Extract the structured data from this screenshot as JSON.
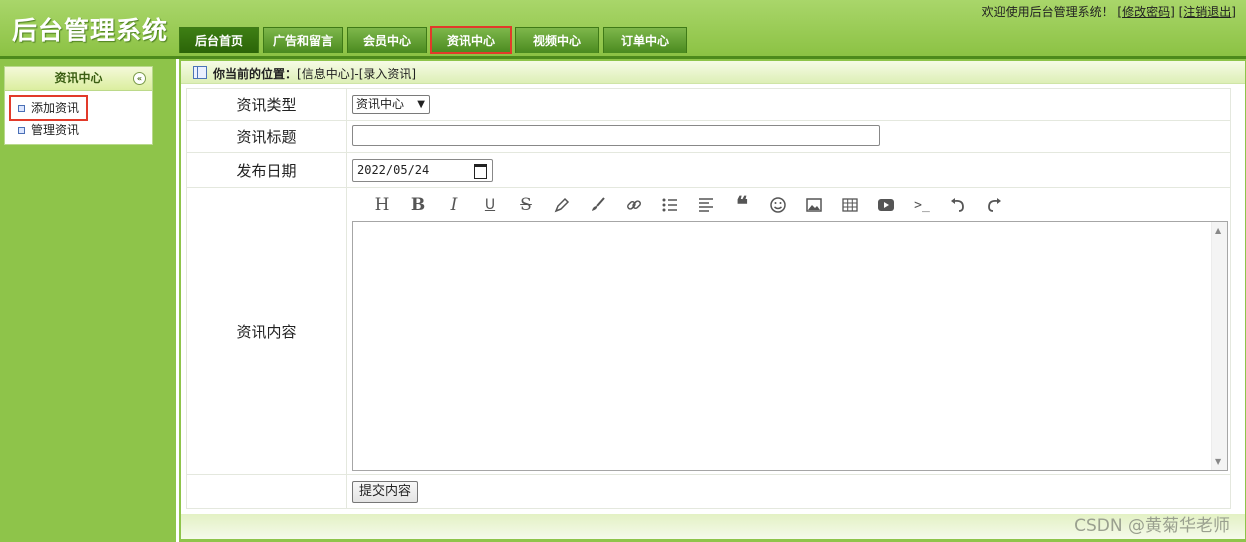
{
  "header": {
    "brand": "后台管理系统",
    "welcome": "欢迎使用后台管理系统！",
    "change_password": "[修改密码]",
    "logout": "[注销退出]"
  },
  "nav": {
    "tabs": [
      {
        "label": "后台首页"
      },
      {
        "label": "广告和留言"
      },
      {
        "label": "会员中心"
      },
      {
        "label": "资讯中心"
      },
      {
        "label": "视频中心"
      },
      {
        "label": "订单中心"
      }
    ],
    "active": "后台首页",
    "highlighted": "资讯中心"
  },
  "sidebar": {
    "title": "资讯中心",
    "collapse_glyph": "«",
    "items": [
      {
        "label": "添加资讯",
        "highlighted": true
      },
      {
        "label": "管理资讯"
      }
    ]
  },
  "breadcrumb": {
    "prefix": "你当前的位置：",
    "path": "[信息中心]-[录入资讯]"
  },
  "form": {
    "type_label": "资讯类型",
    "type_value": "资讯中心",
    "title_label": "资讯标题",
    "title_value": "",
    "date_label": "发布日期",
    "date_value": "2022/05/24",
    "content_label": "资讯内容",
    "submit_label": "提交内容"
  },
  "editor_toolbar": [
    "heading-icon",
    "bold-icon",
    "italic-icon",
    "underline-icon",
    "strikethrough-icon",
    "highlighter-icon",
    "brush-icon",
    "link-icon",
    "unordered-list-icon",
    "align-icon",
    "quote-icon",
    "emoji-icon",
    "image-icon",
    "table-icon",
    "video-icon",
    "code-icon",
    "undo-icon",
    "redo-icon"
  ],
  "watermark": "CSDN @黄菊华老师",
  "colors": {
    "highlight": "#e23a2a",
    "header_green": "#8cc244",
    "tab_dark": "#2b6408"
  }
}
